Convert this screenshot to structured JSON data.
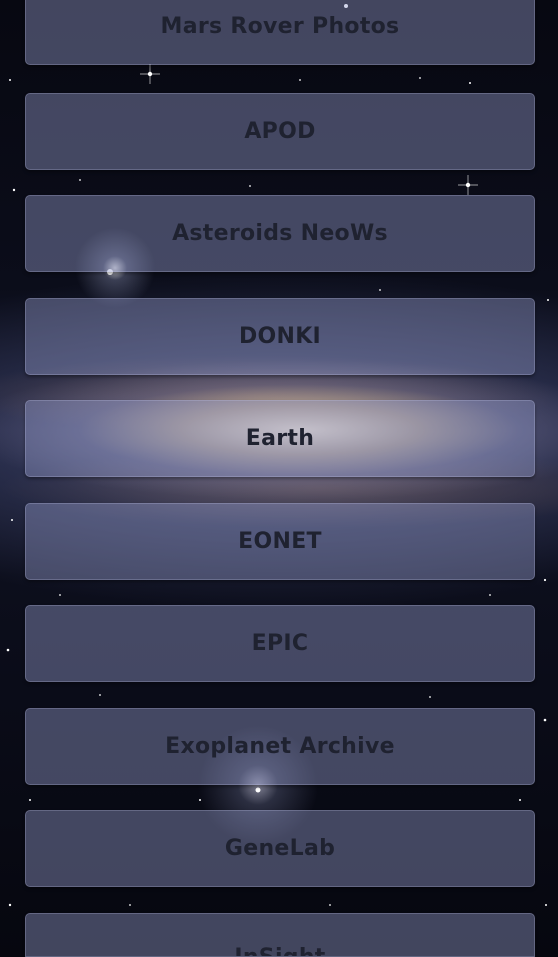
{
  "menu": {
    "items": [
      {
        "label": "Mars Rover Photos"
      },
      {
        "label": "APOD"
      },
      {
        "label": "Asteroids NeoWs"
      },
      {
        "label": "DONKI"
      },
      {
        "label": "Earth"
      },
      {
        "label": "EONET"
      },
      {
        "label": "EPIC"
      },
      {
        "label": "Exoplanet Archive"
      },
      {
        "label": "GeneLab"
      },
      {
        "label": "InSight"
      }
    ]
  },
  "colors": {
    "button_fill": "#969ecd",
    "button_text": "#1f2230",
    "space_background": "#05060c"
  }
}
